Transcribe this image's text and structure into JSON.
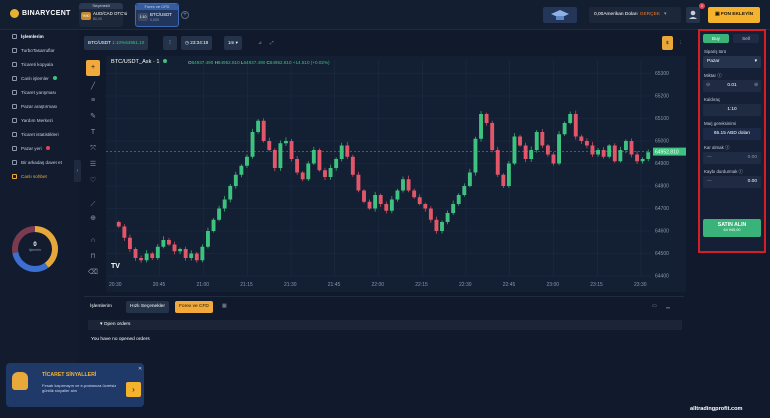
{
  "brand": {
    "name": "BINARYCENT"
  },
  "asset_tabs": [
    {
      "header": "Seçenekli",
      "name": "AUD/CAD OTC'si",
      "badge": "%90",
      "sub": "$0,00"
    },
    {
      "header": "Forex ve CFD",
      "name": "BTC/USDT",
      "badge": "1:10",
      "sub": "0,000"
    }
  ],
  "topbar": {
    "balance": "0,00Amerikan Doları",
    "account_type": "GERÇEK",
    "deposit": "FON EKLEYİN",
    "notifications": "1"
  },
  "sidebar": {
    "items": [
      "İşlemlerim",
      "TurboTasarruflar",
      "Ticareti kopyala",
      "Canlı işlemler",
      "Ticaret yarışması",
      "Pazar araştırması",
      "Yardım Merkezi",
      "Ticaret istatistikleri",
      "Pazar yeri",
      "Bir arkadaş davet et",
      "Canlı sohbet"
    ],
    "donut_value": "0",
    "donut_label": "İşlemler"
  },
  "signals": {
    "title": "TİCARET SİNYALLERİ",
    "desc": "Fırsatı kaçırmayın ve e-postanıza ücretsiz günlük sinyaller alın"
  },
  "chart_header": {
    "symbol": "BTC/USDT",
    "leverage": "1:10%",
    "price": "64951.10",
    "clock": "23:34:18",
    "interval": "1m"
  },
  "chart_legend": {
    "symbol": "BTC/USDT_Ask · 1",
    "o": "64937.490",
    "h": "64952.810",
    "l": "64937.490",
    "c": "64952.810",
    "change": "+14.510 (+0.02%)"
  },
  "chart_data": {
    "type": "candlestick",
    "title": "BTC/USDT_Ask · 1",
    "x_ticks": [
      "20:30",
      "20:45",
      "21:00",
      "21:15",
      "21:30",
      "21:45",
      "22:00",
      "22:15",
      "22:30",
      "22:45",
      "23:00",
      "23:15",
      "23:30"
    ],
    "y_ticks": [
      65300,
      65200,
      65100,
      65000,
      64900,
      64800,
      64700,
      64600,
      64500,
      64400
    ],
    "ylim": [
      64400,
      65360
    ],
    "last_price": 64952.81,
    "up_color": "#3ec27f",
    "down_color": "#e2566a",
    "close_series": [
      64620,
      64570,
      64520,
      64480,
      64470,
      64500,
      64480,
      64530,
      64560,
      64540,
      64510,
      64520,
      64480,
      64500,
      64470,
      64530,
      64600,
      64650,
      64700,
      64740,
      64800,
      64850,
      64890,
      64930,
      65040,
      65090,
      65000,
      64960,
      64880,
      64990,
      65000,
      64920,
      64860,
      64830,
      64900,
      64960,
      64870,
      64840,
      64880,
      64920,
      64980,
      64930,
      64850,
      64780,
      64730,
      64700,
      64760,
      64720,
      64690,
      64740,
      64780,
      64830,
      64780,
      64750,
      64720,
      64700,
      64650,
      64600,
      64640,
      64680,
      64720,
      64760,
      64800,
      64860,
      65010,
      65120,
      65080,
      64960,
      64850,
      64800,
      64900,
      65020,
      64980,
      64920,
      64960,
      65040,
      64980,
      64940,
      64900,
      65030,
      65080,
      65120,
      65020,
      65000,
      64980,
      64940,
      64960,
      64930,
      64980,
      64910,
      64960,
      65000,
      64940,
      64910,
      64920,
      64950
    ]
  },
  "bottom_tabs": {
    "active_label": "İşlemlerim",
    "tab1": "Hızlı Seçenekler",
    "tab2": "Forex ve CFD",
    "open_orders": "Open orders",
    "empty": "You have no opened orders"
  },
  "order_panel": {
    "buy": "Buy",
    "sell": "Sell",
    "order_type_label": "Sipariş türü",
    "order_type": "Pazar",
    "amount_label": "Miktar",
    "amount": "0.01",
    "leverage_label": "Kaldıraç",
    "leverage": "1:10",
    "margin_label": "Marj gereksinimi",
    "margin": "65.15 ABD doları",
    "tp_label": "Kar almak",
    "tp": "0.00",
    "sl_label": "Kaybı durdurmak",
    "sl": "0.00",
    "submit": "SATIN ALIN",
    "submit_sub": "64 945,00"
  },
  "watermark": "alltradingprofit.com"
}
